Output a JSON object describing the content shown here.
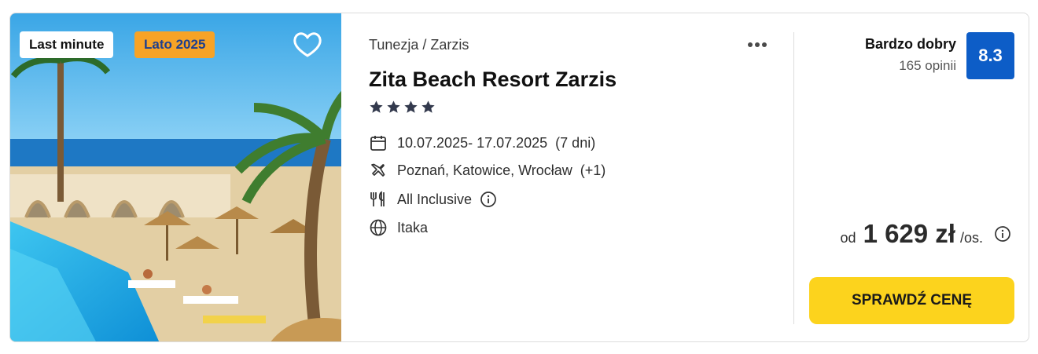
{
  "badges": {
    "last_minute": "Last minute",
    "season": "Lato 2025"
  },
  "hotel": {
    "location": "Tunezja / Zarzis",
    "name": "Zita Beach Resort Zarzis",
    "stars": 4
  },
  "trip": {
    "dates": "10.07.2025- 17.07.2025",
    "duration": "(7 dni)",
    "airports": "Poznań, Katowice, Wrocław",
    "airports_extra": "(+1)",
    "board": "All Inclusive",
    "operator": "Itaka"
  },
  "rating": {
    "label": "Bardzo dobry",
    "reviews": "165 opinii",
    "score": "8.3"
  },
  "price": {
    "prefix": "od",
    "value": "1 629 zł",
    "unit": "/os."
  },
  "cta": {
    "label": "SPRAWDŹ CENĘ"
  },
  "icons": [
    "heart-icon",
    "more-icon",
    "star-icon",
    "calendar-icon",
    "plane-icon",
    "cutlery-icon",
    "info-icon",
    "globe-icon"
  ],
  "colors": {
    "rating_bg": "#0d5dc7",
    "cta_bg": "#fcd31d",
    "season_badge": "#f7a326"
  }
}
